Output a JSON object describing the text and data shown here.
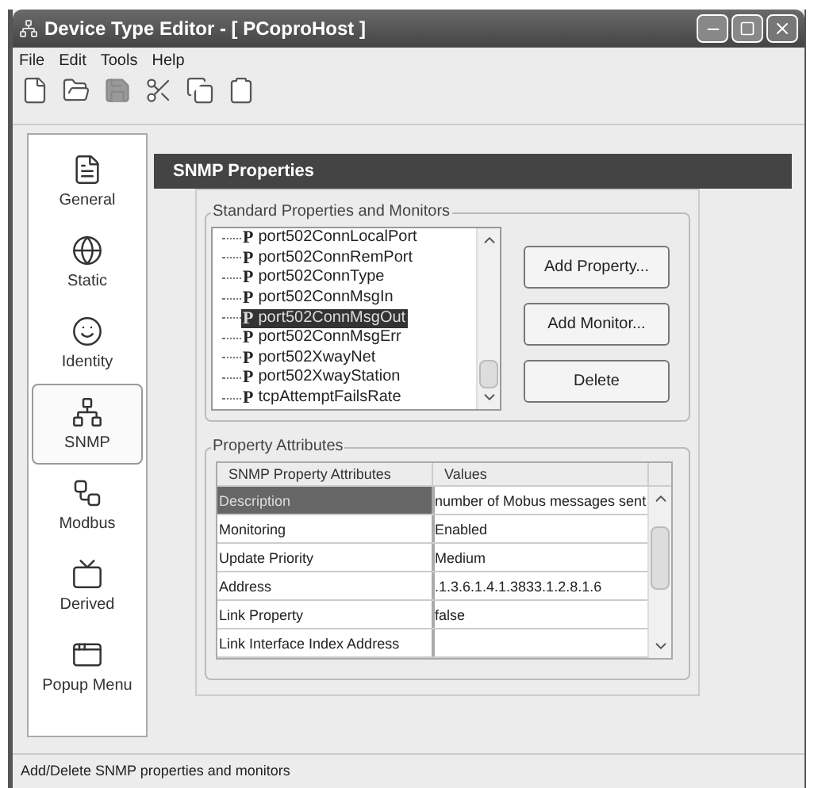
{
  "window": {
    "title": "Device Type Editor - [ PCoproHost ]"
  },
  "menu": [
    {
      "label": "File"
    },
    {
      "label": "Edit"
    },
    {
      "label": "Tools"
    },
    {
      "label": "Help"
    }
  ],
  "toolbar": [
    {
      "kind": "new",
      "disabled": false
    },
    {
      "kind": "open",
      "disabled": false
    },
    {
      "kind": "save",
      "disabled": true
    },
    {
      "kind": "cut",
      "disabled": false
    },
    {
      "kind": "copy",
      "disabled": false
    },
    {
      "kind": "paste",
      "disabled": false
    }
  ],
  "sidebar": {
    "items": [
      {
        "label": "General",
        "kind": "general",
        "selected": false
      },
      {
        "label": "Static",
        "kind": "static",
        "selected": false
      },
      {
        "label": "Identity",
        "kind": "identity",
        "selected": false
      },
      {
        "label": "SNMP",
        "kind": "snmp",
        "selected": true
      },
      {
        "label": "Modbus",
        "kind": "modbus",
        "selected": false
      },
      {
        "label": "Derived",
        "kind": "derived",
        "selected": false
      },
      {
        "label": "Popup Menu",
        "kind": "popup",
        "selected": false
      }
    ]
  },
  "header": {
    "title": "SNMP Properties"
  },
  "standard": {
    "title": "Standard Properties and Monitors",
    "items": [
      {
        "icon": "P",
        "label": "port502ConnLocalPort",
        "selected": false
      },
      {
        "icon": "P",
        "label": "port502ConnRemPort",
        "selected": false
      },
      {
        "icon": "P",
        "label": "port502ConnType",
        "selected": false
      },
      {
        "icon": "P",
        "label": "port502ConnMsgIn",
        "selected": false
      },
      {
        "icon": "P",
        "label": "port502ConnMsgOut",
        "selected": true
      },
      {
        "icon": "P",
        "label": "port502ConnMsgErr",
        "selected": false
      },
      {
        "icon": "P",
        "label": "port502XwayNet",
        "selected": false
      },
      {
        "icon": "P",
        "label": "port502XwayStation",
        "selected": false
      },
      {
        "icon": "P",
        "label": "tcpAttemptFailsRate",
        "selected": false
      }
    ],
    "buttons": [
      "Add Property...",
      "Add Monitor...",
      "Delete"
    ]
  },
  "attributes": {
    "title": "Property Attributes",
    "columns": [
      "SNMP Property Attributes",
      "Values"
    ],
    "rows": [
      {
        "name": "Description",
        "value": "number of Mobus messages sent",
        "selected": true
      },
      {
        "name": "Monitoring",
        "value": "Enabled",
        "selected": false
      },
      {
        "name": "Update Priority",
        "value": "Medium",
        "selected": false
      },
      {
        "name": "Address",
        "value": ".1.3.6.1.4.1.3833.1.2.8.1.6",
        "selected": false
      },
      {
        "name": "Link Property",
        "value": "false",
        "selected": false
      },
      {
        "name": "Link Interface Index Address",
        "value": "",
        "selected": false
      }
    ]
  },
  "status_bar": {
    "text": "Add/Delete SNMP properties and monitors"
  }
}
